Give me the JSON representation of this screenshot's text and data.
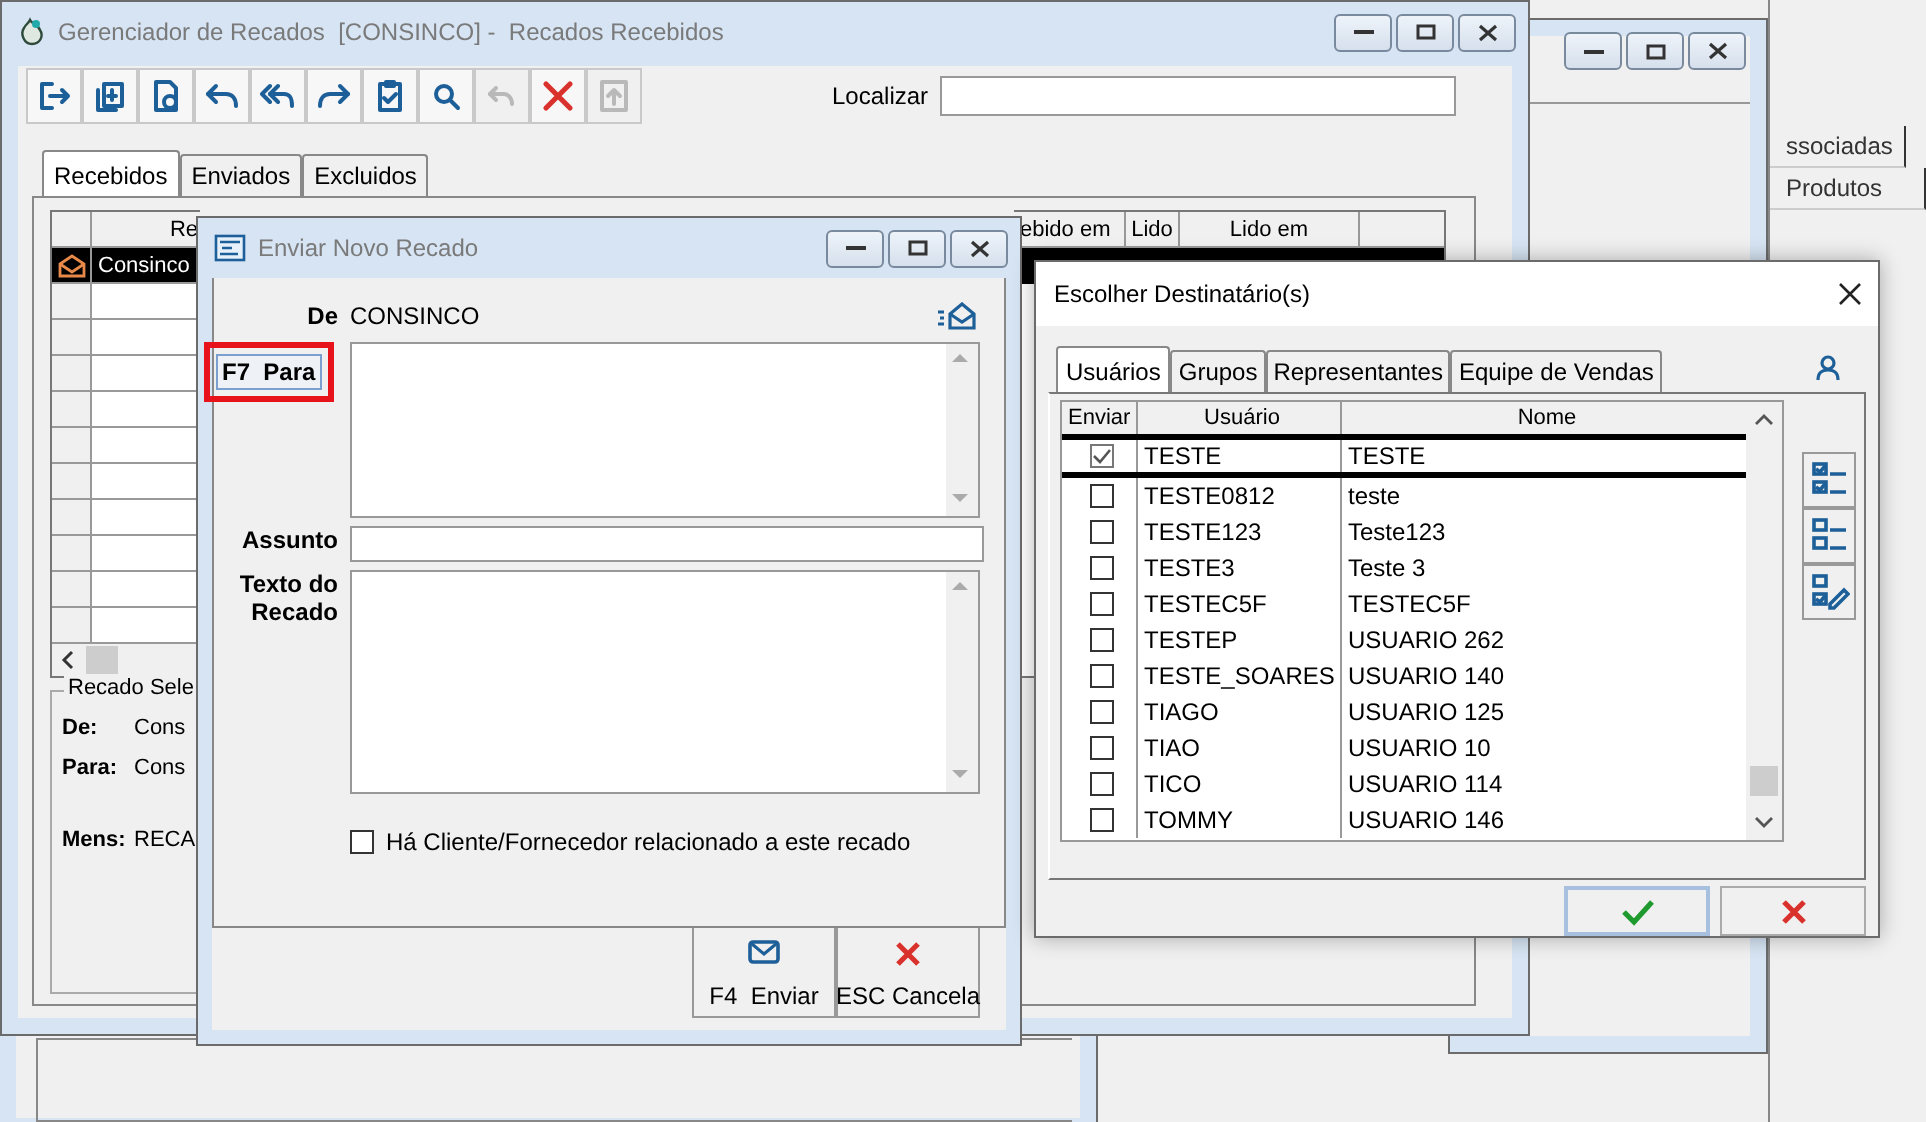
{
  "far_window": {
    "tabs": [
      {
        "label": "ssociadas"
      },
      {
        "label": "Produtos"
      }
    ]
  },
  "main_window": {
    "title": "Gerenciador de Recados  [CONSINCO] -  Recados Recebidos",
    "toolbar": [
      {
        "kind": "exit",
        "disabled": false
      },
      {
        "kind": "new",
        "disabled": false
      },
      {
        "kind": "preview",
        "disabled": false
      },
      {
        "kind": "reply",
        "disabled": false
      },
      {
        "kind": "reply-all",
        "disabled": false
      },
      {
        "kind": "forward",
        "disabled": false
      },
      {
        "kind": "checklist",
        "disabled": false
      },
      {
        "kind": "search",
        "disabled": false
      },
      {
        "kind": "undo",
        "disabled": true
      },
      {
        "kind": "delete",
        "disabled": false
      },
      {
        "kind": "archive",
        "disabled": true
      }
    ],
    "search_label": "Localizar",
    "tabs": [
      {
        "label": "Recebidos",
        "selected": true
      },
      {
        "label": "Enviados",
        "selected": false
      },
      {
        "label": "Excluidos",
        "selected": false
      }
    ],
    "grid_left": {
      "header": "Re",
      "rows": [
        {
          "text": "Consinco",
          "selected": true
        }
      ]
    },
    "grid_right": {
      "columns": [
        "ebido em",
        "Lido",
        "Lido em"
      ],
      "rows": [
        {
          "selected": true
        }
      ]
    },
    "selected_message": {
      "legend": "Recado Sele",
      "fields": [
        {
          "label": "De:",
          "value": "Cons"
        },
        {
          "label": "Para:",
          "value": "Cons"
        },
        {
          "label": "Mens:",
          "value": "RECA"
        }
      ]
    }
  },
  "send_dialog": {
    "title": "Enviar Novo Recado",
    "from_label": "De",
    "from_value": "CONSINCO",
    "to_button": "F7  Para",
    "subject_label": "Assunto",
    "body_label": "Texto do Recado",
    "related_checkbox": {
      "label": "Há Cliente/Fornecedor relacionado a este recado",
      "checked": false
    },
    "buttons": [
      {
        "kind": "send",
        "label": "F4  Enviar"
      },
      {
        "kind": "cancel",
        "label": "ESC Cancela"
      }
    ]
  },
  "recipients_dialog": {
    "title": "Escolher Destinatário(s)",
    "tabs": [
      {
        "label": "Usuários",
        "selected": true
      },
      {
        "label": "Grupos",
        "selected": false
      },
      {
        "label": "Representantes",
        "selected": false
      },
      {
        "label": "Equipe de Vendas",
        "selected": false
      }
    ],
    "columns": [
      "Enviar",
      "Usuário",
      "Nome"
    ],
    "rows": [
      {
        "user": "TESTE",
        "name": "TESTE",
        "checked": true,
        "selected": true
      },
      {
        "user": "TESTE0812",
        "name": "teste",
        "checked": false,
        "selected": false
      },
      {
        "user": "TESTE123",
        "name": "Teste123",
        "checked": false,
        "selected": false
      },
      {
        "user": "TESTE3",
        "name": "Teste 3",
        "checked": false,
        "selected": false
      },
      {
        "user": "TESTEC5F",
        "name": "TESTEC5F",
        "checked": false,
        "selected": false
      },
      {
        "user": "TESTEP",
        "name": "USUARIO 262",
        "checked": false,
        "selected": false
      },
      {
        "user": "TESTE_SOARES",
        "name": "USUARIO 140",
        "checked": false,
        "selected": false
      },
      {
        "user": "TIAGO",
        "name": "USUARIO 125",
        "checked": false,
        "selected": false
      },
      {
        "user": "TIAO",
        "name": "USUARIO 10",
        "checked": false,
        "selected": false
      },
      {
        "user": "TICO",
        "name": "USUARIO 114",
        "checked": false,
        "selected": false
      },
      {
        "user": "TOMMY",
        "name": "USUARIO 146",
        "checked": false,
        "selected": false
      }
    ],
    "side_buttons": [
      {
        "kind": "check-all"
      },
      {
        "kind": "uncheck-all"
      },
      {
        "kind": "invert"
      }
    ],
    "buttons": [
      {
        "kind": "ok"
      },
      {
        "kind": "cancel"
      }
    ]
  }
}
